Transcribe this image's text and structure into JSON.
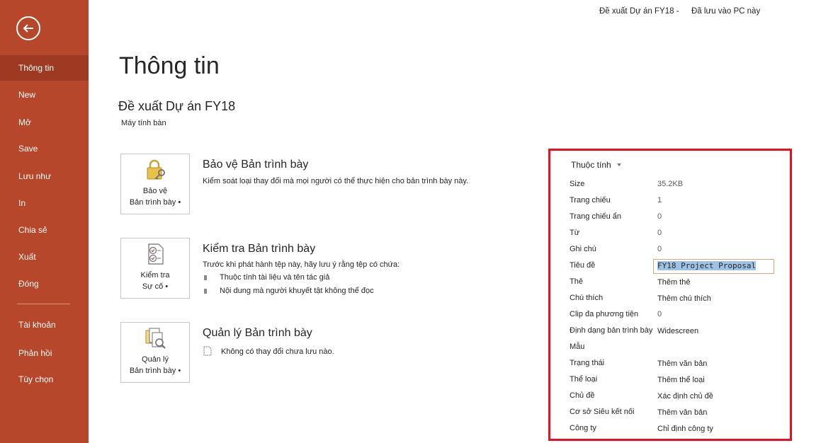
{
  "sidebar": {
    "back_label": "",
    "items": [
      {
        "label": "Thông tin",
        "active": true
      },
      {
        "label": "New"
      },
      {
        "label": "Mở"
      },
      {
        "label": "Save"
      },
      {
        "label": "Lưu như"
      },
      {
        "label": "In"
      },
      {
        "label": "Chia sẻ"
      },
      {
        "label": "Xuất"
      },
      {
        "label": "Đóng"
      },
      {
        "label": "Tài khoản"
      },
      {
        "label": "Phản hồi"
      },
      {
        "label": "Tùy chọn"
      }
    ]
  },
  "titlebar": {
    "doc_name": "Đề xuất Dự án FY18 -",
    "save_status": "Đã lưu vào PC này"
  },
  "main": {
    "page_title": "Thông tin",
    "doc_title": "Đề xuất Dự án FY18",
    "doc_location": "Máy tính bàn",
    "sections": [
      {
        "tile_label_1": "Bảo vệ",
        "tile_label_2": "Bản trình bày •",
        "heading": "Bảo vệ Bản trình bày",
        "description": "Kiểm soát loại thay đổi mà mọi người có thể thực hiện cho bản trình bày này."
      },
      {
        "tile_label_1": "Kiểm tra",
        "tile_label_2": "Sự cố •",
        "heading": "Kiểm tra Bản trình bày",
        "description": "Trước khi phát hành tệp này, hãy lưu ý rằng tệp có chứa:",
        "bullets": [
          "Thuộc tính tài liệu và tên tác giả",
          "Nội dung mà người khuyết tật không thể đọc"
        ]
      },
      {
        "tile_label_1": "Quản lý",
        "tile_label_2": "Bản trình bày •",
        "heading": "Quản lý Bản trình bày",
        "description": "Không có thay đổi chưa lưu nào."
      }
    ]
  },
  "properties": {
    "header": "Thuộc tính",
    "rows": [
      {
        "label": "Size",
        "value": "35.2KB"
      },
      {
        "label": "Trang chiếu",
        "value": "1"
      },
      {
        "label": "Trang chiếu ẩn",
        "value": "0"
      },
      {
        "label": "Từ",
        "value": "0"
      },
      {
        "label": "Ghi chú",
        "value": "0"
      },
      {
        "label": "Tiêu đề",
        "value": "FY18 Project Proposal"
      },
      {
        "label": "Thẻ",
        "value": "Thêm thẻ"
      },
      {
        "label": "Chú thích",
        "value": "Thêm chú thích"
      },
      {
        "label": "Clip đa phương tiện",
        "value": "0"
      },
      {
        "label": "Định dạng bản trình bày",
        "value": "Widescreen"
      },
      {
        "label": "Mẫu",
        "value": ""
      },
      {
        "label": "Trạng thái",
        "value": "Thêm văn bản"
      },
      {
        "label": "Thể loại",
        "value": "Thêm thể loại"
      },
      {
        "label": "Chủ đề",
        "value": "Xác định chủ đề"
      },
      {
        "label": "Cơ sở Siêu kết nối",
        "value": "Thêm văn bản"
      },
      {
        "label": "Công ty",
        "value": "Chỉ định công ty"
      }
    ]
  },
  "colors": {
    "sidebar_bg": "#b7472a",
    "sidebar_active": "#9e3a21",
    "highlight_frame": "#e81123"
  }
}
